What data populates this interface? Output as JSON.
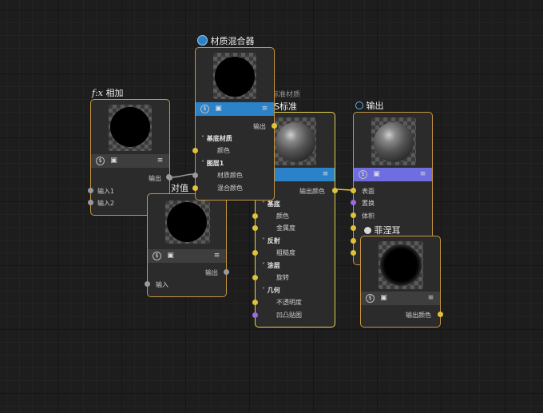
{
  "nodes": {
    "add": {
      "title": "相加",
      "func_prefix": "f:x",
      "output_label": "输出",
      "inputs": [
        "输入1",
        "输入2"
      ]
    },
    "abs": {
      "title": "对值",
      "output_label": "输出",
      "input_label": "输入"
    },
    "mixer": {
      "title": "材质混合器",
      "output_label": "输出",
      "section_base": "基底材质",
      "base_color": "颜色",
      "section_layer": "图层1",
      "layer_material_color": "材质颜色",
      "layer_mix_color": "混合颜色"
    },
    "standard": {
      "title": "S标准",
      "behind_label": "标准材质",
      "output_color_label": "输出颜色",
      "sections": [
        {
          "label": "基底",
          "items": [
            "颜色",
            "金属度"
          ]
        },
        {
          "label": "反射",
          "items": [
            "粗糙度"
          ]
        },
        {
          "label": "涂层",
          "items": [
            "旋转"
          ]
        },
        {
          "label": "几何",
          "items": [
            "不透明度",
            "凹凸贴图"
          ]
        }
      ]
    },
    "output": {
      "title": "输出",
      "inputs": [
        "表面",
        "置换",
        "体积"
      ]
    },
    "fresnel": {
      "title": "菲涅耳",
      "output_label": "输出颜色"
    }
  },
  "icons": {
    "coin": "$",
    "image": "▣",
    "menu": "≡",
    "chevron": "˅"
  },
  "colors": {
    "node_border": "#c79640",
    "selected_border": "#e6d24a",
    "title_bar_blue": "#2c82c9",
    "title_bar_violet": "#6e6ee0",
    "port_yellow": "#e0c23a",
    "port_purple": "#9b6be0",
    "port_gray": "#9a9a9a"
  }
}
